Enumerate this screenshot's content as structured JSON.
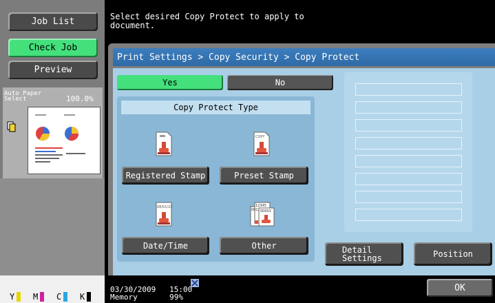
{
  "sidebar": {
    "job_list": "Job List",
    "check_job": "Check Job",
    "preview": "Preview",
    "auto_paper": "Auto Paper\nSelect",
    "zoom": "100.0%"
  },
  "message": "Select desired Copy Protect to apply to\ndocument.",
  "breadcrumb": "Print Settings > Copy Security > Copy Protect",
  "toggle": {
    "yes": "Yes",
    "no": "No",
    "selected": "Yes"
  },
  "copy_protect": {
    "header": "Copy Protect Type",
    "registered_stamp": "Registered Stamp",
    "preset_stamp": "Preset Stamp",
    "date_time": "Date/Time",
    "other": "Other",
    "date_icon_text": "08/01/23",
    "copy_icon_text": "COPY",
    "number_icon_text": "12345",
    "number_icon_text2": "0012",
    "number_icon_text3": "00001"
  },
  "actions": {
    "detail_settings": "Detail\nSettings",
    "position": "Position",
    "ok": "OK"
  },
  "toner": [
    "Y",
    "M",
    "C",
    "K"
  ],
  "status": {
    "date": "03/30/2009",
    "time": "15:00",
    "memory_label": "Memory",
    "memory_value": "99%"
  },
  "colors": {
    "accent_green": "#44e07c",
    "title_blue": "#2f6aa6",
    "panel_blue": "#a9cfe6",
    "toner_yellow": "#e8d400",
    "toner_magenta": "#d21fa0",
    "toner_cyan": "#2aa7e0",
    "toner_black": "#000000"
  }
}
